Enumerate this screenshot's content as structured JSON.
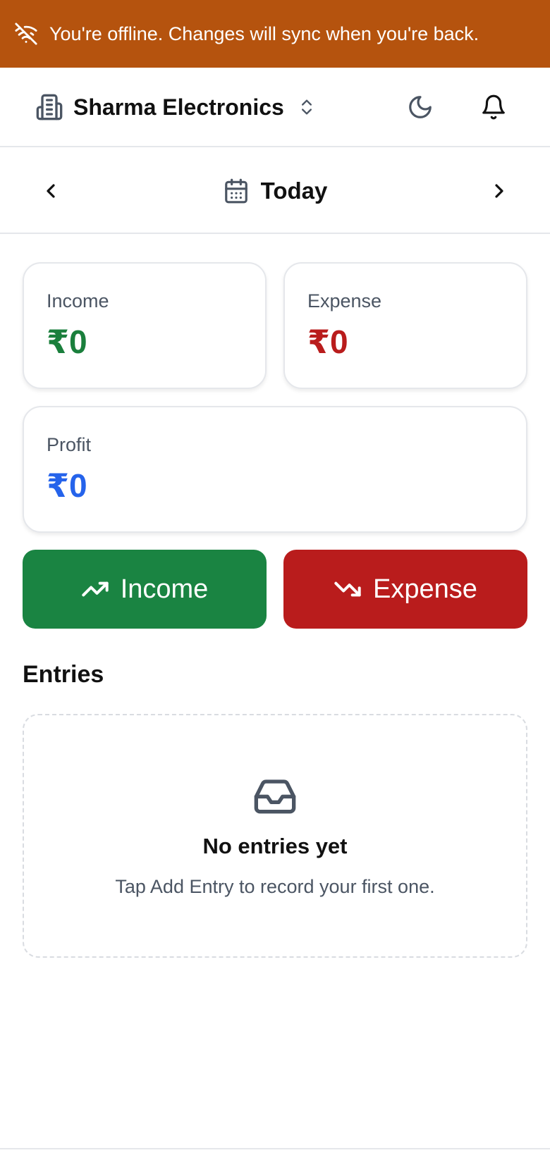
{
  "offline_banner": {
    "icon": "wifi-off-icon",
    "message": "You're offline. Changes will sync when you're back.",
    "color": "#b5530e"
  },
  "header": {
    "business_name": "Sharma Electronics",
    "business_icon": "building-icon",
    "switcher_icon": "chevrons-up-down-icon",
    "theme_icon": "moon-icon",
    "notifications_icon": "bell-icon"
  },
  "date_nav": {
    "label": "Today",
    "calendar_icon": "calendar-icon",
    "prev_icon": "chevron-left-icon",
    "next_icon": "chevron-right-icon"
  },
  "summary": {
    "income": {
      "label": "Income",
      "value": "₹0",
      "color": "#1a7f3c"
    },
    "expense": {
      "label": "Expense",
      "value": "₹0",
      "color": "#b91c1c"
    },
    "profit": {
      "label": "Profit",
      "value": "₹0",
      "color": "#2563eb"
    }
  },
  "actions": {
    "income_label": "Income",
    "income_icon": "trending-up-icon",
    "income_color": "#1a8442",
    "expense_label": "Expense",
    "expense_icon": "trending-down-icon",
    "expense_color": "#b91c1c"
  },
  "entries": {
    "title": "Entries",
    "empty_icon": "inbox-icon",
    "empty_title": "No entries yet",
    "empty_subtitle": "Tap Add Entry to record your first one."
  }
}
